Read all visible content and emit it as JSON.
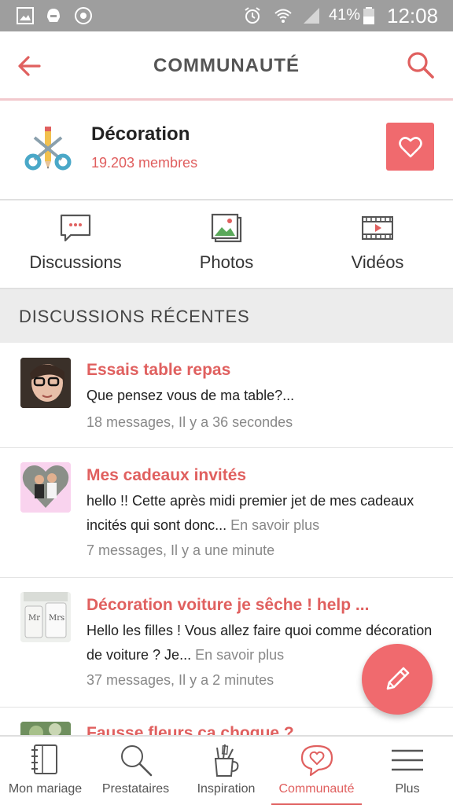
{
  "status_bar": {
    "battery_percent": "41%",
    "time": "12:08",
    "icons": [
      "image-icon",
      "helmet-icon",
      "settings-badge-icon",
      "alarm-icon",
      "wifi-icon",
      "signal-icon",
      "battery-icon"
    ]
  },
  "app_bar": {
    "title": "COMMUNAUTÉ",
    "back_icon": "arrow-left-icon",
    "search_icon": "search-icon"
  },
  "community": {
    "name": "Décoration",
    "members": "19.203 membres",
    "logo_icon": "scissors-pencil-icon",
    "favorite_icon": "heart-icon"
  },
  "tabs": [
    {
      "label": "Discussions",
      "icon": "chat-bubble-icon"
    },
    {
      "label": "Photos",
      "icon": "photos-icon"
    },
    {
      "label": "Vidéos",
      "icon": "video-icon"
    }
  ],
  "section": {
    "title": "DISCUSSIONS RÉCENTES"
  },
  "discussions": [
    {
      "title": "Essais table repas",
      "body": "Que pensez vous de ma table?...",
      "more": "",
      "meta": "18 messages, Il y a 36 secondes"
    },
    {
      "title": "Mes cadeaux invités",
      "body": "hello !! Cette après midi premier jet de mes cadeaux incités qui sont donc... ",
      "more": "En savoir plus",
      "meta": "7 messages, Il y a une minute"
    },
    {
      "title": "Décoration voiture je sêche ! help ...",
      "body": "Hello les filles ! Vous allez faire quoi comme décoration de voiture ? Je... ",
      "more": "En savoir plus",
      "meta": "37 messages, Il y a 2 minutes"
    },
    {
      "title": "Fausse fleurs ça choque ?",
      "body": "",
      "more": "",
      "meta": ""
    }
  ],
  "fab": {
    "icon": "pencil-icon"
  },
  "bottom_nav": [
    {
      "label": "Mon mariage",
      "icon": "notebook-icon",
      "active": false
    },
    {
      "label": "Prestataires",
      "icon": "search-icon",
      "active": false
    },
    {
      "label": "Inspiration",
      "icon": "pencil-cup-icon",
      "active": false
    },
    {
      "label": "Communauté",
      "icon": "heart-bubble-icon",
      "active": true
    },
    {
      "label": "Plus",
      "icon": "menu-icon",
      "active": false
    }
  ],
  "colors": {
    "accent": "#e0605f",
    "fav_button": "#f06a6e",
    "status_bar": "#9e9e9e",
    "section_bg": "#ececec"
  }
}
